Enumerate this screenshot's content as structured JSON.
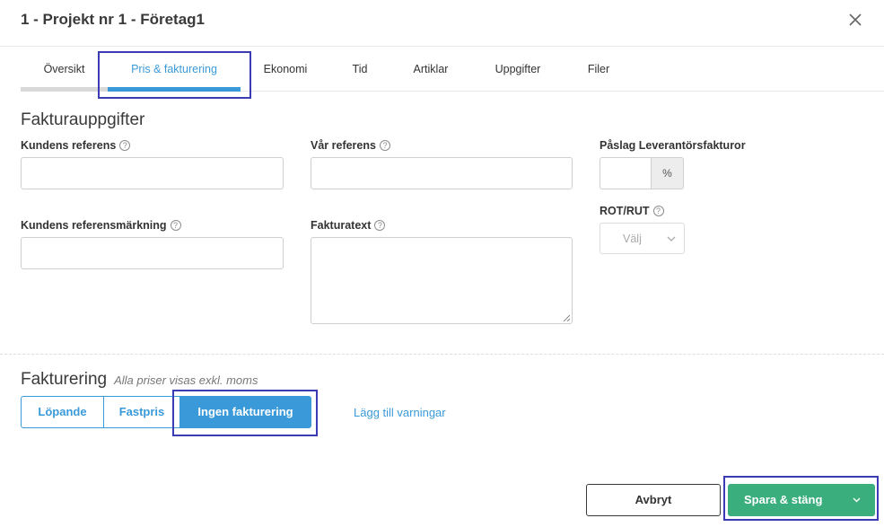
{
  "modal": {
    "title": "1 - Projekt nr 1 - Företag1"
  },
  "tabs": [
    {
      "label": "Översikt",
      "active": false
    },
    {
      "label": "Pris & fakturering",
      "active": true
    },
    {
      "label": "Ekonomi",
      "active": false
    },
    {
      "label": "Tid",
      "active": false
    },
    {
      "label": "Artiklar",
      "active": false
    },
    {
      "label": "Uppgifter",
      "active": false
    },
    {
      "label": "Filer",
      "active": false
    }
  ],
  "invoice_details": {
    "title": "Fakturauppgifter",
    "customer_reference": {
      "label": "Kundens referens",
      "value": ""
    },
    "our_reference": {
      "label": "Vår referens",
      "value": ""
    },
    "supplier_markup": {
      "label": "Påslag Leverantörsfakturor",
      "value": "",
      "unit": "%"
    },
    "customer_reference_marking": {
      "label": "Kundens referensmärkning",
      "value": ""
    },
    "invoice_text": {
      "label": "Fakturatext",
      "value": ""
    },
    "rot_rut": {
      "label": "ROT/RUT",
      "selected": "Välj"
    }
  },
  "billing": {
    "title": "Fakturering",
    "note": "Alla priser visas exkl. moms",
    "options": [
      {
        "label": "Löpande",
        "active": false
      },
      {
        "label": "Fastpris",
        "active": false
      },
      {
        "label": "Ingen fakturering",
        "active": true
      }
    ],
    "add_warnings_link": "Lägg till varningar"
  },
  "footer": {
    "cancel_label": "Avbryt",
    "save_label": "Spara & stäng"
  },
  "colors": {
    "accent": "#3a9ad9",
    "save_button": "#3bae7e",
    "highlight_outline": "#3b3bb3"
  },
  "icons": {
    "close": "close-icon",
    "help": "help-circle-icon",
    "select_chevron": "chevron-down-icon",
    "save_dropdown": "chevron-down-icon"
  }
}
